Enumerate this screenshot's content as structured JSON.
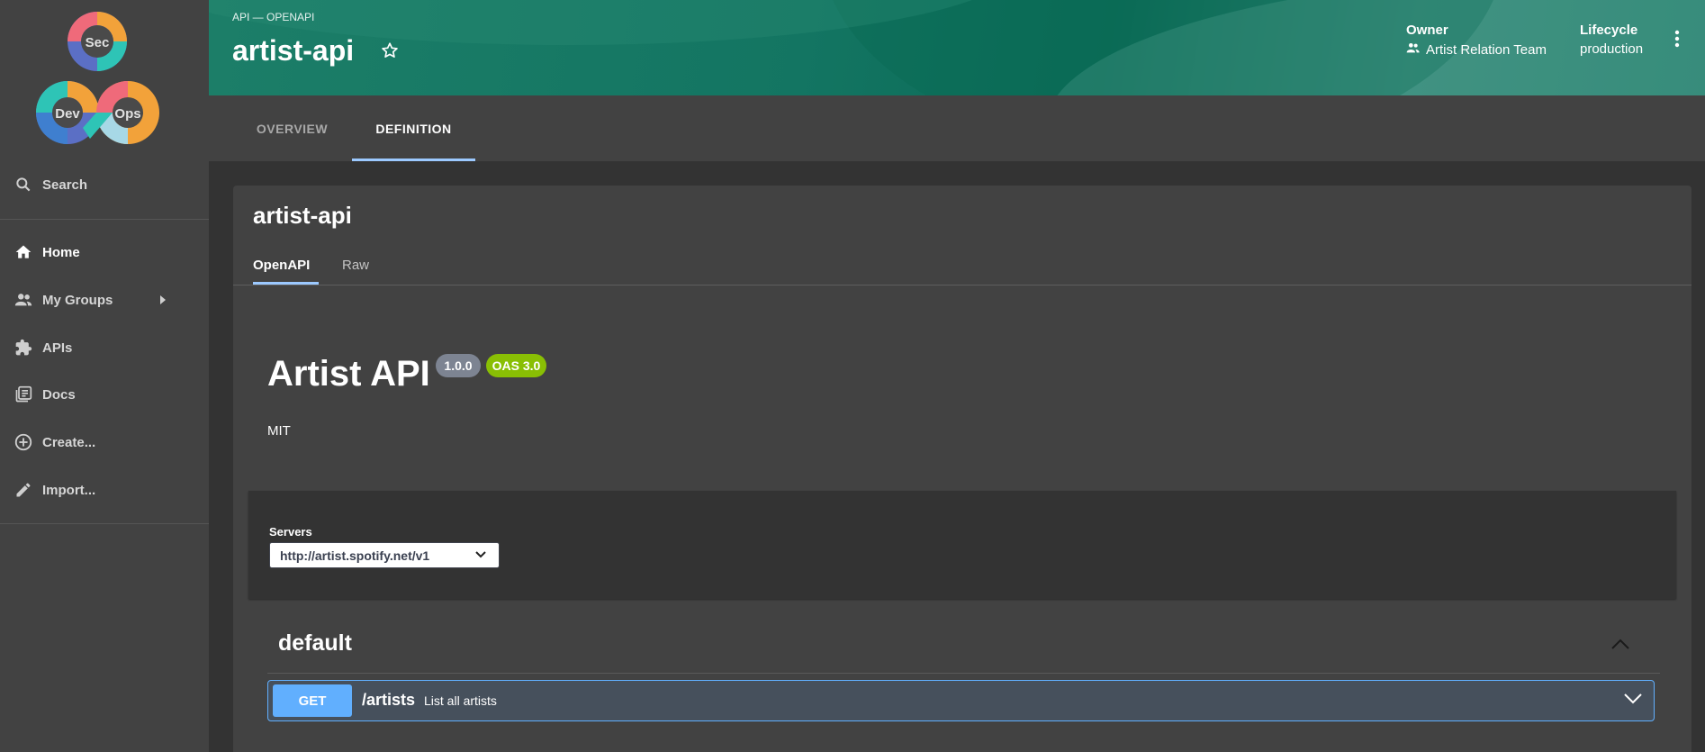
{
  "sidebar": {
    "logo": {
      "sec": "Sec",
      "dev": "Dev",
      "ops": "Ops"
    },
    "search_label": "Search",
    "items": [
      {
        "label": "Home",
        "icon": "home-icon"
      },
      {
        "label": "My Groups",
        "icon": "group-icon"
      },
      {
        "label": "APIs",
        "icon": "puzzle-icon"
      },
      {
        "label": "Docs",
        "icon": "library-icon"
      },
      {
        "label": "Create...",
        "icon": "add-circle-icon"
      },
      {
        "label": "Import...",
        "icon": "pencil-icon"
      }
    ]
  },
  "header": {
    "kind": "API — OPENAPI",
    "title": "artist-api",
    "owner_label": "Owner",
    "owner_value": "Artist Relation Team",
    "lifecycle_label": "Lifecycle",
    "lifecycle_value": "production"
  },
  "tabs": [
    {
      "label": "OVERVIEW"
    },
    {
      "label": "DEFINITION"
    }
  ],
  "card": {
    "title": "artist-api",
    "subtabs": [
      "OpenAPI",
      "Raw"
    ],
    "api": {
      "title": "Artist API",
      "version": "1.0.0",
      "oas": "OAS 3.0",
      "license": "MIT"
    },
    "servers": {
      "label": "Servers",
      "selected": "http://artist.spotify.net/v1"
    },
    "section": {
      "title": "default",
      "operations": [
        {
          "method": "GET",
          "path": "/artists",
          "summary": "List all artists"
        }
      ]
    }
  },
  "colors": {
    "get_method": "#61affe",
    "oas_badge": "#89bf04",
    "version_badge": "#7d8492",
    "tab_indicator": "#9cc9ff"
  }
}
